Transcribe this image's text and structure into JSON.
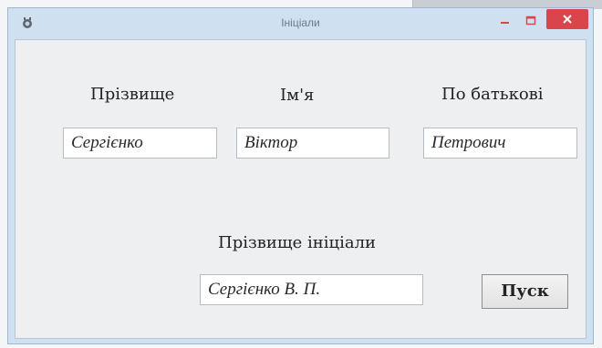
{
  "window": {
    "title": "Ініціали"
  },
  "labels": {
    "surname": "Прізвище",
    "name": "Ім'я",
    "patronymic": "По батькові",
    "result": "Прізвище ініціали"
  },
  "fields": {
    "surname": "Сергієнко",
    "name": "Віктор",
    "patronymic": "Петрович",
    "result": "Сергієнко В. П."
  },
  "buttons": {
    "start": "Пуск"
  },
  "colors": {
    "close_button": "#d9454a",
    "titlebar": "#cfe0f0"
  }
}
